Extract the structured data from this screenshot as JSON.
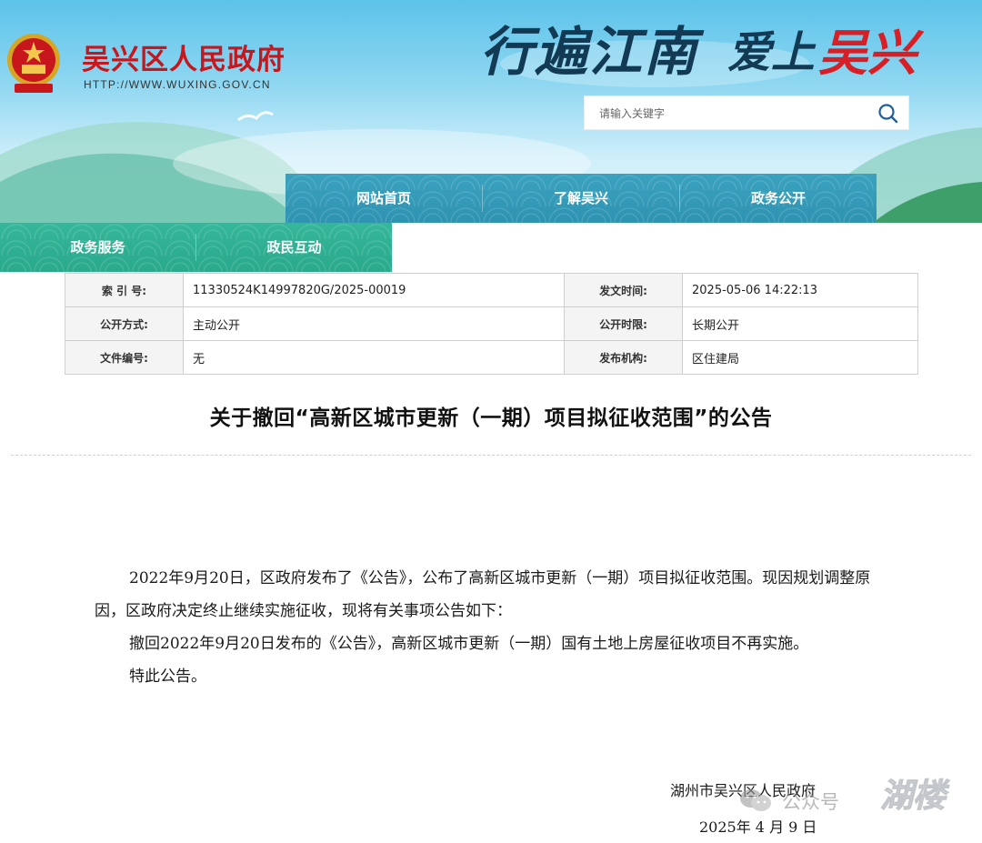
{
  "header": {
    "site_name": "吴兴区人民政府",
    "site_url": "HTTP://WWW.WUXING.GOV.CN",
    "slogan_part1": "行遍江南",
    "slogan_part2": "爱上",
    "slogan_part3": "吴兴",
    "colors": {
      "sky": "#5cc3ea",
      "site_name": "#c8161d",
      "slogan_red": "#d91f26",
      "slogan_dark": "#123a55"
    }
  },
  "search": {
    "placeholder": "请输入关键字",
    "icon": "search-icon"
  },
  "nav": {
    "row1": [
      {
        "label": "网站首页"
      },
      {
        "label": "了解吴兴"
      },
      {
        "label": "政务公开"
      }
    ],
    "row2": [
      {
        "label": "政务服务"
      },
      {
        "label": "政民互动"
      }
    ],
    "colors": {
      "row1": "#2e93b1",
      "row2": "#2aa98b"
    }
  },
  "info": {
    "index_label": "索 引 号:",
    "index_value": "11330524K14997820G/2025-00019",
    "date_label": "发文时间:",
    "date_value": "2025-05-06 14:22:13",
    "method_label": "公开方式:",
    "method_value": "主动公开",
    "period_label": "公开时限:",
    "period_value": "长期公开",
    "doc_label": "文件编号:",
    "doc_value": "无",
    "org_label": "发布机构:",
    "org_value": "区住建局"
  },
  "article": {
    "title": "关于撤回“高新区城市更新（一期）项目拟征收范围”的公告",
    "paragraphs": [
      "2022年9月20日，区政府发布了《公告》，公布了高新区城市更新（一期）项目拟征收范围。现因规划调整原因，区政府决定终止继续实施征收，现将有关事项公告如下：",
      "撤回2022年9月20日发布的《公告》，高新区城市更新（一期）国有土地上房屋征收项目不再实施。",
      "特此公告。"
    ],
    "signature": "湖州市吴兴区人民政府",
    "sign_date": "2025年 4 月 9 日"
  },
  "watermark": {
    "icon": "wechat-icon",
    "text": "公众号",
    "name": "湖楼"
  }
}
